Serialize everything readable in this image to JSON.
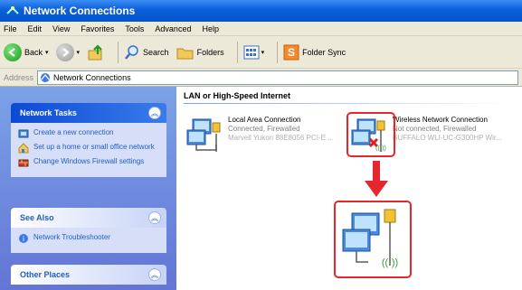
{
  "window": {
    "title": "Network Connections"
  },
  "menu": [
    "File",
    "Edit",
    "View",
    "Favorites",
    "Tools",
    "Advanced",
    "Help"
  ],
  "toolbar": {
    "back": "Back",
    "search": "Search",
    "folders": "Folders",
    "folder_sync": "Folder Sync"
  },
  "address": {
    "label": "Address",
    "value": "Network Connections"
  },
  "network_tasks": {
    "title": "Network Tasks",
    "items": [
      "Create a new connection",
      "Set up a home or small office network",
      "Change Windows Firewall settings"
    ]
  },
  "see_also": {
    "title": "See Also",
    "items": [
      "Network Troubleshooter"
    ]
  },
  "other_places": {
    "title": "Other Places"
  },
  "main": {
    "group_title": "LAN or High-Speed Internet",
    "connections": [
      {
        "name": "Local Area Connection",
        "status": "Connected, Firewalled",
        "device": "Marvell Yukon 88E8056 PCI-E ..."
      },
      {
        "name": "Wireless Network Connection",
        "status": "Not connected, Firewalled",
        "device": "BUFFALO WLI-UC-G300HP Wir..."
      }
    ]
  },
  "colors": {
    "highlight": "#e6262d",
    "title_blue": "#0a5fd8"
  }
}
